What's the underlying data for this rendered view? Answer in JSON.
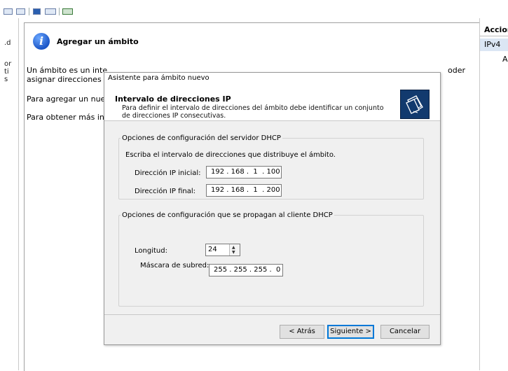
{
  "left_panel": {
    "fragments": [
      ".d",
      "or",
      "ti",
      "s"
    ]
  },
  "main": {
    "banner_title": "Agregar un ámbito",
    "desc_line1": "Un ámbito es un inte",
    "desc_line1_tail": "oder",
    "desc_line2": "asignar direcciones IP",
    "desc_line3": "Para agregar un nuev",
    "desc_line4": "Para obtener más inf"
  },
  "actions": {
    "header": "Accion",
    "ipv4": "IPv4",
    "item": "Ac"
  },
  "dialog": {
    "title": "Asistente para ámbito nuevo",
    "header_title": "Intervalo de direcciones IP",
    "header_subtitle": "Para definir el intervalo de direcciones del ámbito debe identificar un conjunto de direcciones IP consecutivas.",
    "server_group": {
      "legend": "Opciones de configuración del servidor DHCP",
      "instruction": "Escriba el intervalo de direcciones que distribuye el ámbito.",
      "start_label": "Dirección IP inicial:",
      "start_value": "192 . 168 .  1  . 100",
      "end_label": "Dirección IP final:",
      "end_value": "192 . 168 .  1  . 200"
    },
    "client_group": {
      "legend": "Opciones de configuración que se propagan al cliente DHCP",
      "length_label": "Longitud:",
      "length_value": "24",
      "mask_label": "Máscara de subred:",
      "mask_value": "255 . 255 . 255 .  0"
    },
    "buttons": {
      "back": "< Atrás",
      "next": "Siguiente >",
      "cancel": "Cancelar"
    }
  }
}
